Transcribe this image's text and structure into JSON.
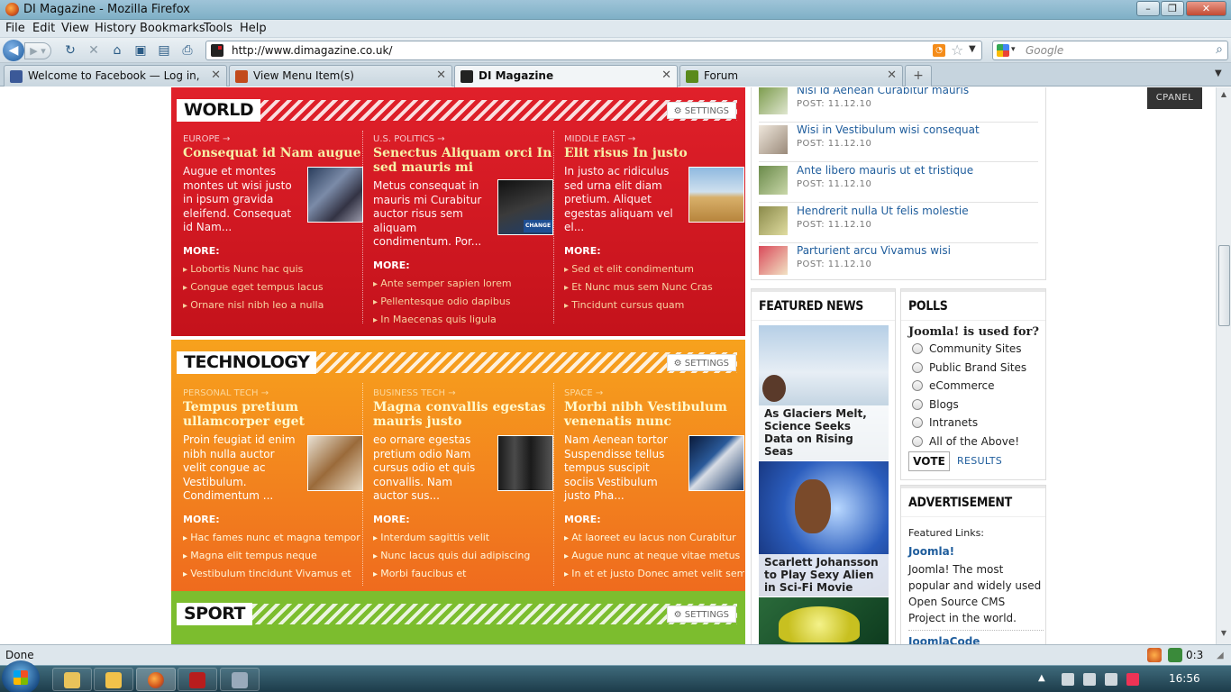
{
  "window": {
    "title": "DI Magazine - Mozilla Firefox",
    "minimize": "–",
    "maximize": "❐",
    "close": "✕"
  },
  "menu": [
    "File",
    "Edit",
    "View",
    "History",
    "Bookmarks",
    "Tools",
    "Help"
  ],
  "nav": {
    "url": "http://www.dimagazine.co.uk/",
    "search_placeholder": "Google"
  },
  "tabs": [
    {
      "label": "Welcome to Facebook — Log in, si...",
      "icon_color": "#3b5998"
    },
    {
      "label": "View Menu Item(s)",
      "icon_color": "#c24a1c"
    },
    {
      "label": "DI Magazine",
      "icon_color": "#222222",
      "active": true
    },
    {
      "label": "Forum",
      "icon_color": "#5a8a1c"
    }
  ],
  "tab_new": "+",
  "sections": {
    "world": {
      "title": "WORLD",
      "settings": "SETTINGS",
      "color": "#d6171f",
      "columns": [
        {
          "cat": "EUROPE →",
          "headline": "Consequat id Nam augue",
          "body": "Augue et montes montes ut wisi justo in ipsum gravida eleifend. Consequat id Nam...",
          "more": "MORE:",
          "links": [
            "Lobortis Nunc hac quis",
            "Congue eget tempus lacus",
            "Ornare nisl nibh leo a nulla"
          ]
        },
        {
          "cat": "U.S. POLITICS →",
          "headline": "Senectus Aliquam orci In sed mauris mi",
          "body": "Metus consequat in mauris mi Curabitur auctor risus sem aliquam condimentum. Por...",
          "more": "MORE:",
          "links": [
            "Ante semper sapien lorem",
            "Pellentesque odio dapibus",
            "In Maecenas quis ligula"
          ],
          "img_label": "CHANGE"
        },
        {
          "cat": "MIDDLE EAST →",
          "headline": "Elit risus In justo",
          "body": "In justo ac ridiculus sed urna elit diam pretium. Aliquet egestas aliquam vel el...",
          "more": "MORE:",
          "links": [
            "Sed et elit condimentum",
            "Et Nunc mus sem Nunc Cras",
            "Tincidunt cursus quam"
          ]
        }
      ]
    },
    "technology": {
      "title": "TECHNOLOGY",
      "settings": "SETTINGS",
      "color": "#f28a1e",
      "columns": [
        {
          "cat": "PERSONAL TECH →",
          "headline": "Tempus pretium ullamcorper eget",
          "body": "Proin feugiat id enim nibh nulla auctor velit congue ac Vestibulum. Condimentum ...",
          "more": "MORE:",
          "links": [
            "Hac fames nunc et magna tempor",
            "Magna elit tempus neque",
            "Vestibulum tincidunt Vivamus et"
          ]
        },
        {
          "cat": "BUSINESS TECH →",
          "headline": "Magna convallis egestas mauris justo",
          "body": "eo ornare egestas pretium odio Nam cursus odio et quis convallis. Nam auctor sus...",
          "more": "MORE:",
          "links": [
            "Interdum sagittis velit",
            "Nunc lacus quis dui adipiscing",
            "Morbi faucibus et"
          ]
        },
        {
          "cat": "SPACE →",
          "headline": "Morbi nibh Vestibulum venenatis nunc",
          "body": "Nam Aenean tortor Suspendisse tellus tempus suscipit sociis Vestibulum justo Pha...",
          "more": "MORE:",
          "links": [
            "At laoreet eu lacus non Curabitur",
            "Augue nunc at neque vitae metus",
            "In et et justo Donec amet velit sem"
          ]
        }
      ]
    },
    "sport": {
      "title": "SPORT",
      "settings": "SETTINGS",
      "color": "#7cbd2e"
    }
  },
  "recent": [
    {
      "title": "Nisl id Aenean Curabitur mauris",
      "date": "POST: 11.12.10"
    },
    {
      "title": "Wisi in Vestibulum wisi consequat",
      "date": "POST: 11.12.10"
    },
    {
      "title": "Ante libero mauris ut et tristique",
      "date": "POST: 11.12.10"
    },
    {
      "title": "Hendrerit nulla Ut felis molestie",
      "date": "POST: 11.12.10"
    },
    {
      "title": "Parturient arcu Vivamus wisi",
      "date": "POST: 11.12.10"
    }
  ],
  "featured": {
    "title": "FEATURED NEWS",
    "items": [
      {
        "caption": "As Glaciers Melt, Science Seeks Data on Rising Seas"
      },
      {
        "caption": "Scarlett Johansson to Play Sexy Alien in Sci-Fi Movie"
      },
      {
        "caption": ""
      }
    ]
  },
  "polls": {
    "title": "POLLS",
    "question": "Joomla! is used for?",
    "options": [
      "Community Sites",
      "Public Brand Sites",
      "eCommerce",
      "Blogs",
      "Intranets",
      "All of the Above!"
    ],
    "vote": "VOTE",
    "results": "RESULTS"
  },
  "ad": {
    "title": "ADVERTISEMENT",
    "intro": "Featured Links:",
    "link1": "Joomla!",
    "desc1": "Joomla! The most popular and widely used Open Source CMS Project in the world.",
    "link2": "JoomlaCode"
  },
  "cpanel": "CPANEL",
  "status": {
    "text": "Done",
    "count": "0:3"
  },
  "taskbar": {
    "time": "16:56",
    "tray_arrow": "▲"
  }
}
